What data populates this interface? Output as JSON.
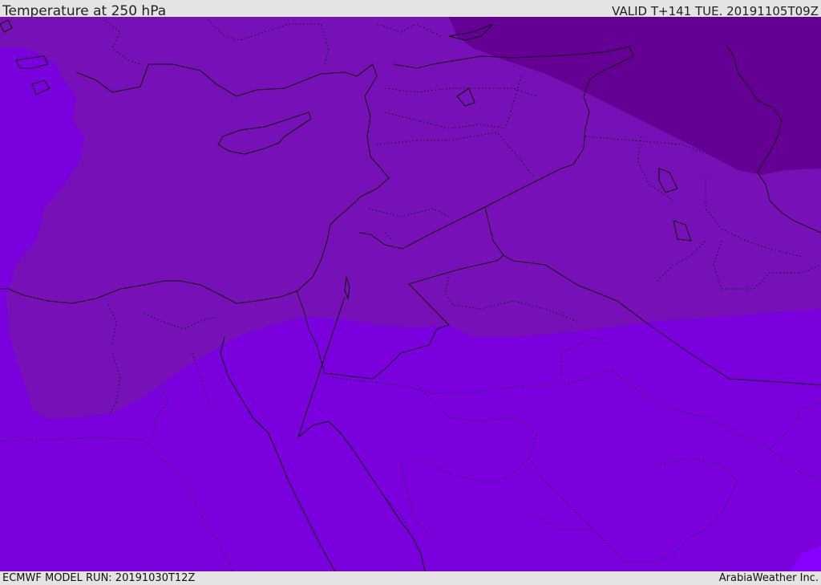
{
  "header": {
    "title": "Temperature at 250 hPa",
    "valid": "VALID T+141 TUE. 20191105T09Z"
  },
  "footer": {
    "model_run": "ECMWF MODEL RUN: 20191030T12Z",
    "credit": "ArabiaWeather Inc."
  },
  "map": {
    "colors": {
      "band_warm": "#7a00de",
      "band_mid": "#7710b6",
      "band_cold": "#650095",
      "band_warmest": "#8800ff",
      "border": "#111111"
    }
  }
}
